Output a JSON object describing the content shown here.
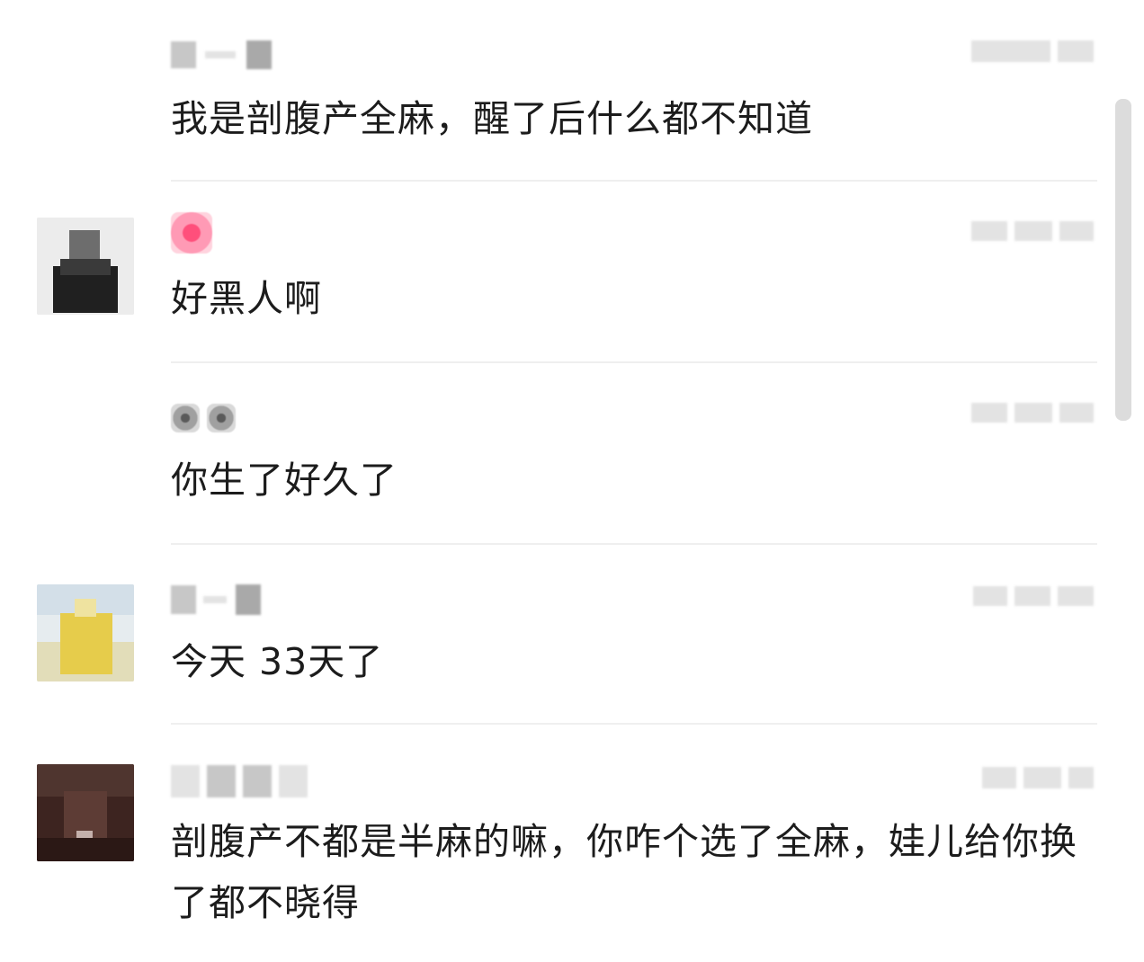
{
  "comments": [
    {
      "text": "我是剖腹产全麻，醒了后什么都不知道"
    },
    {
      "text": "好黑人啊"
    },
    {
      "text": "你生了好久了"
    },
    {
      "text": "今天 33天了"
    },
    {
      "text": "剖腹产不都是半麻的嘛，你咋个选了全麻，娃儿给你换了都不晓得"
    }
  ],
  "icons": {
    "avatar_1": "user-avatar-dark-shirt",
    "avatar_2": "user-avatar-yellow-scene",
    "avatar_3": "user-avatar-dark-portrait"
  }
}
